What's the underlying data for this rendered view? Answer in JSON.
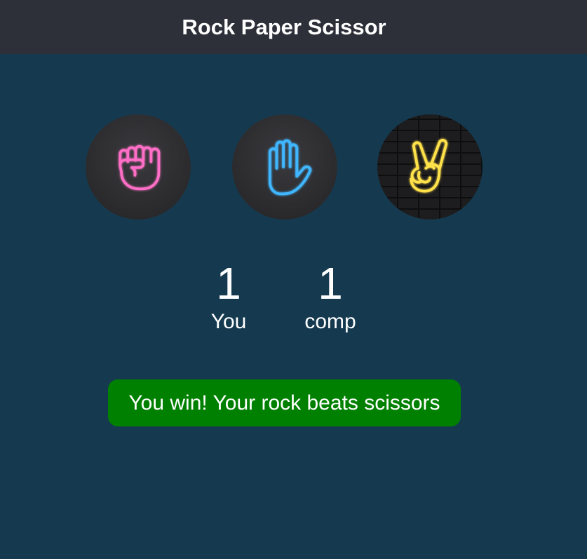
{
  "app": {
    "title": "Rock Paper Scissor"
  },
  "choices": [
    {
      "id": "rock",
      "icon": "neon-fist-icon",
      "color": "#ff6ec7"
    },
    {
      "id": "paper",
      "icon": "neon-open-hand-icon",
      "color": "#3fb6ff"
    },
    {
      "id": "scissors",
      "icon": "neon-peace-sign-icon",
      "color": "#ffe14a"
    }
  ],
  "scoreboard": {
    "user": {
      "score": "1",
      "label": "You"
    },
    "comp": {
      "score": "1",
      "label": "comp"
    }
  },
  "message": {
    "text": "You win! Your rock beats scissors",
    "background": "#008000"
  },
  "colors": {
    "page_background": "#153a50",
    "header_background": "#2d3039"
  }
}
